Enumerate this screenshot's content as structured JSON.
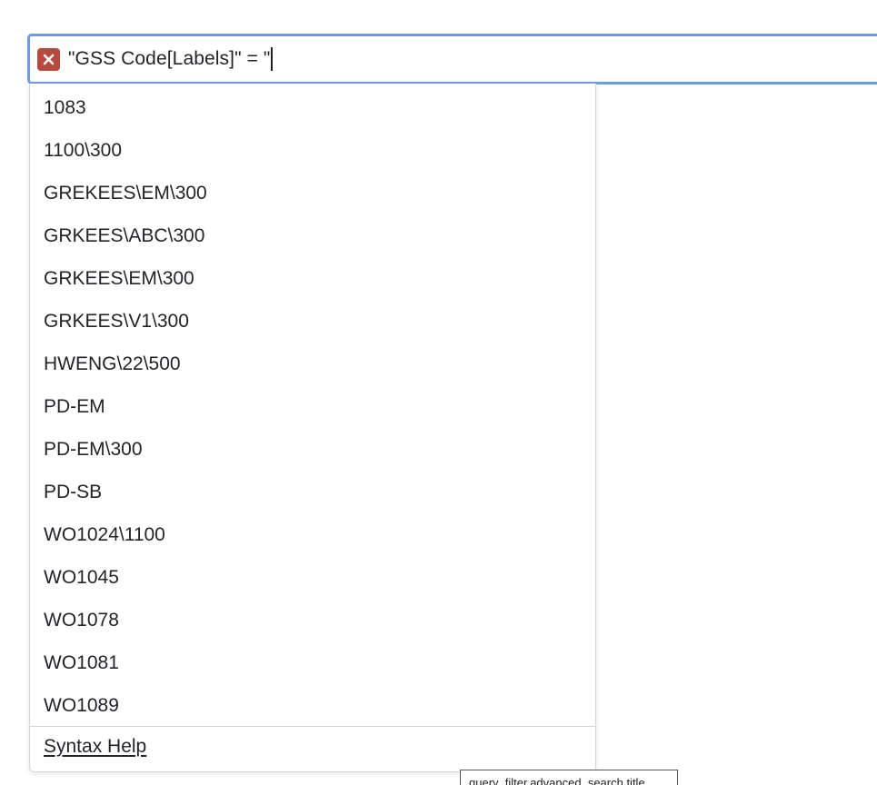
{
  "search": {
    "query": "\"GSS Code[Labels]\" = \"",
    "clear_icon": "close-icon",
    "accent_color": "#6f9be0",
    "clear_color": "#b74a3f"
  },
  "dropdown": {
    "suggestions": [
      "1083",
      "1100\\300",
      "GREKEES\\EM\\300",
      "GRKEES\\ABC\\300",
      "GRKEES\\EM\\300",
      "GRKEES\\V1\\300",
      "HWENG\\22\\500",
      "PD-EM",
      "PD-EM\\300",
      "PD-SB",
      "WO1024\\1100",
      "WO1045",
      "WO1078",
      "WO1081",
      "WO1089"
    ],
    "syntax_help_label": "Syntax Help"
  },
  "tooltip": {
    "text": "query_filter.advanced_search.title"
  }
}
